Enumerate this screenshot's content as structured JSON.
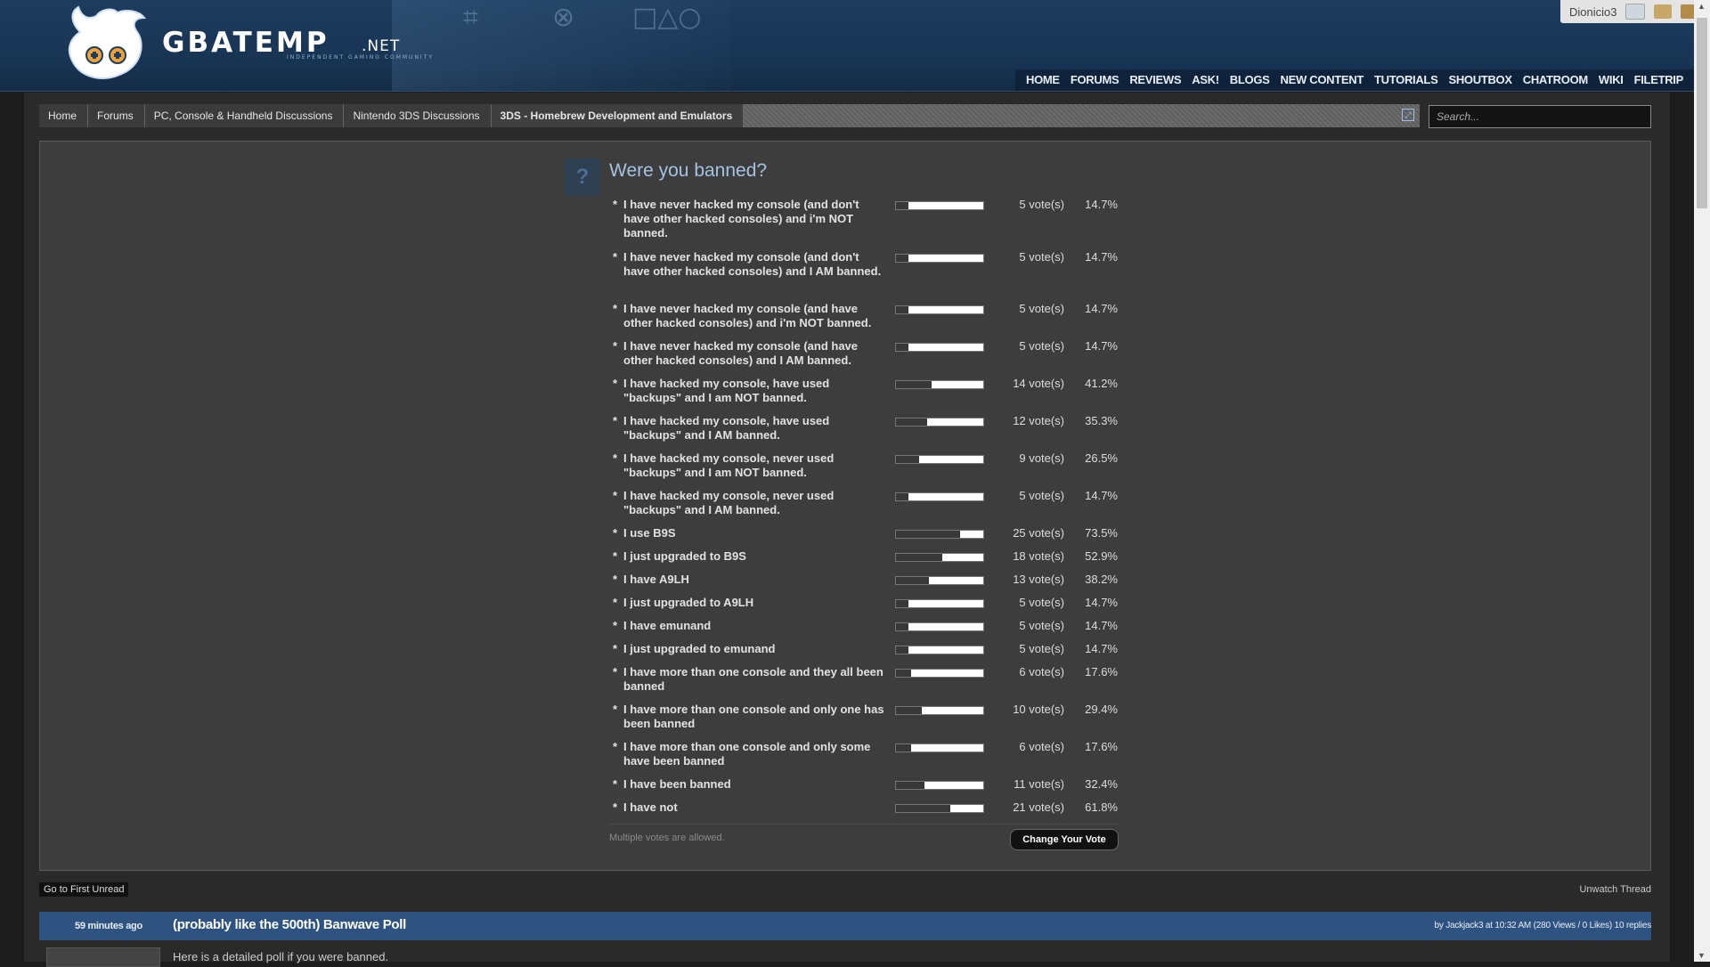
{
  "header": {
    "logo_text": "GBATEMP",
    "logo_suffix": ".NET",
    "logo_tagline": "Independent Gaming Community",
    "nav": [
      "HOME",
      "FORUMS",
      "REVIEWS",
      "ASK!",
      "BLOGS",
      "NEW CONTENT",
      "TUTORIALS",
      "SHOUTBOX",
      "CHATROOM",
      "WIKI",
      "FILETRIP"
    ],
    "username": "Dionicio3"
  },
  "breadcrumb": [
    "Home",
    "Forums",
    "PC, Console & Handheld Discussions",
    "Nintendo 3DS Discussions",
    "3DS - Homebrew Development and Emulators"
  ],
  "search": {
    "placeholder": "Search..."
  },
  "poll": {
    "question": "Were you banned?",
    "options": [
      {
        "label": "I have never hacked my console (and don't have other hacked consoles) and i'm NOT banned.",
        "votes": "5 vote(s)",
        "pct": "14.7%",
        "fraction": 0.147
      },
      {
        "label": "I have never hacked my console (and don't have other hacked consoles) and I AM banned.",
        "votes": "5 vote(s)",
        "pct": "14.7%",
        "fraction": 0.147
      },
      {
        "label": "I have never hacked my console (and have other hacked consoles) and i'm NOT banned.",
        "votes": "5 vote(s)",
        "pct": "14.7%",
        "fraction": 0.147
      },
      {
        "label": "I have never hacked my console (and have other hacked consoles) and I AM banned.",
        "votes": "5 vote(s)",
        "pct": "14.7%",
        "fraction": 0.147
      },
      {
        "label": "I have hacked my console, have used \"backups\" and I am NOT banned.",
        "votes": "14 vote(s)",
        "pct": "41.2%",
        "fraction": 0.412
      },
      {
        "label": "I have hacked my console, have used \"backups\" and I AM banned.",
        "votes": "12 vote(s)",
        "pct": "35.3%",
        "fraction": 0.353
      },
      {
        "label": "I have hacked my console, never used \"backups\" and I am NOT banned.",
        "votes": "9 vote(s)",
        "pct": "26.5%",
        "fraction": 0.265
      },
      {
        "label": "I have hacked my console, never used \"backups\" and I AM banned.",
        "votes": "5 vote(s)",
        "pct": "14.7%",
        "fraction": 0.147
      },
      {
        "label": "I use B9S",
        "votes": "25 vote(s)",
        "pct": "73.5%",
        "fraction": 0.735
      },
      {
        "label": "I just upgraded to B9S",
        "votes": "18 vote(s)",
        "pct": "52.9%",
        "fraction": 0.529
      },
      {
        "label": "I have A9LH",
        "votes": "13 vote(s)",
        "pct": "38.2%",
        "fraction": 0.382
      },
      {
        "label": "I just upgraded to A9LH",
        "votes": "5 vote(s)",
        "pct": "14.7%",
        "fraction": 0.147
      },
      {
        "label": "I have emunand",
        "votes": "5 vote(s)",
        "pct": "14.7%",
        "fraction": 0.147
      },
      {
        "label": "I just upgraded to emunand",
        "votes": "5 vote(s)",
        "pct": "14.7%",
        "fraction": 0.147
      },
      {
        "label": "I have more than one console and they all been banned",
        "votes": "6 vote(s)",
        "pct": "17.6%",
        "fraction": 0.176
      },
      {
        "label": "I have more than one console and only one has been banned",
        "votes": "10 vote(s)",
        "pct": "29.4%",
        "fraction": 0.294
      },
      {
        "label": "I have more than one console and only some have been banned",
        "votes": "6 vote(s)",
        "pct": "17.6%",
        "fraction": 0.176
      },
      {
        "label": "I have been banned",
        "votes": "11 vote(s)",
        "pct": "32.4%",
        "fraction": 0.324
      },
      {
        "label": "I have not",
        "votes": "21 vote(s)",
        "pct": "61.8%",
        "fraction": 0.618
      }
    ],
    "multiple_note": "Multiple votes are allowed.",
    "change_vote_label": "Change Your Vote"
  },
  "thread_controls": {
    "first_unread": "Go to First Unread",
    "unwatch": "Unwatch Thread"
  },
  "thread": {
    "time": "59 minutes ago",
    "title": "(probably like the 500th) Banwave Poll",
    "meta": "by Jackjack3 at 10:32 AM (280 Views / 0 Likes) 10 replies",
    "body": "Here is a detailed poll if you were banned."
  }
}
